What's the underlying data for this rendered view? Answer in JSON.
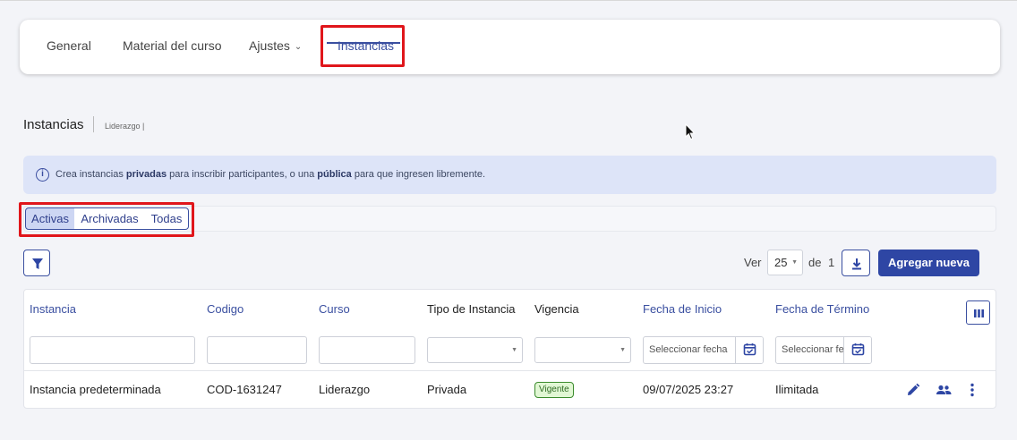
{
  "tabs": [
    {
      "label": "General"
    },
    {
      "label": "Material del curso"
    },
    {
      "label": "Ajustes"
    },
    {
      "label": "Instancias"
    }
  ],
  "header": {
    "title": "Instancias",
    "breadcrumb": "Liderazgo |"
  },
  "info": {
    "pre": "Crea instancias ",
    "bold1": "privadas",
    "mid": " para inscribir participantes, o una ",
    "bold2": "pública",
    "post": " para que ingresen libremente."
  },
  "segments": [
    {
      "label": "Activas"
    },
    {
      "label": "Archivadas"
    },
    {
      "label": "Todas"
    }
  ],
  "toolbar": {
    "ver_label": "Ver",
    "page_size": "25",
    "de_label": "de",
    "total_pages": "1",
    "add_label": "Agregar nueva"
  },
  "table": {
    "headers": [
      "Instancia",
      "Codigo",
      "Curso",
      "Tipo de Instancia",
      "Vigencia",
      "Fecha de Inicio",
      "Fecha de Término"
    ],
    "date_placeholders": [
      "Seleccionar fecha",
      "Seleccionar fecha"
    ],
    "rows": [
      {
        "instancia": "Instancia predeterminada",
        "codigo": "COD-1631247",
        "curso": "Liderazgo",
        "tipo": "Privada",
        "vigencia": "Vigente",
        "inicio": "09/07/2025 23:27",
        "termino": "Ilimitada"
      }
    ]
  },
  "colors": {
    "accent": "#2e46a4",
    "highlight": "#e0161b",
    "status_ok": "#3c8c2e"
  }
}
